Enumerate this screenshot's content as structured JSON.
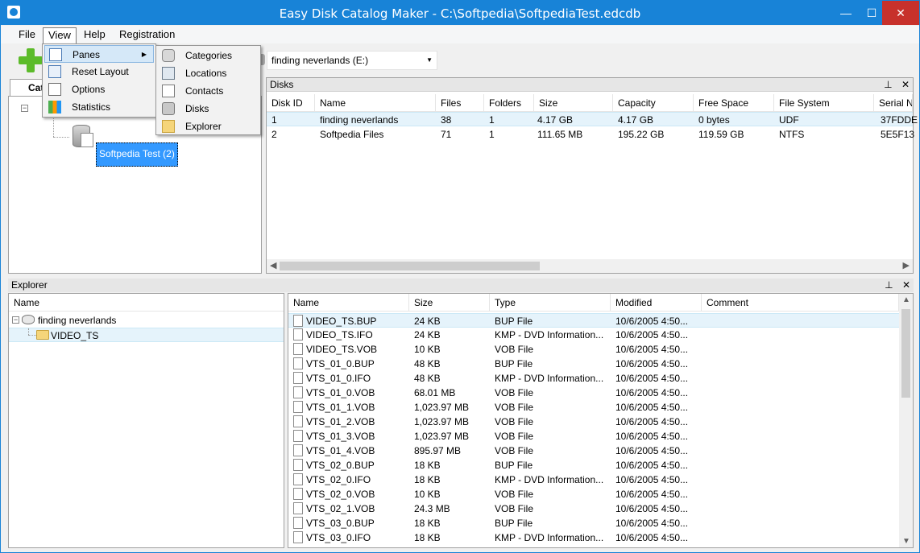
{
  "window": {
    "title": "Easy Disk Catalog Maker - C:\\Softpedia\\SoftpediaTest.edcdb"
  },
  "window_controls": {
    "minimize": "—",
    "maximize": "☐",
    "close": "✕"
  },
  "menubar": [
    "File",
    "View",
    "Help",
    "Registration"
  ],
  "toolbar": {
    "disk_select_value": "finding neverlands (E:)"
  },
  "categories_pane": {
    "tab_label": "Cat",
    "selected_node": "Softpedia Test (2)"
  },
  "view_menu": {
    "items": [
      {
        "label": "Panes",
        "icon": "panes-icon"
      },
      {
        "label": "Reset Layout",
        "icon": "reset-layout-icon"
      },
      {
        "label": "Options",
        "icon": "options-icon"
      },
      {
        "label": "Statistics",
        "icon": "statistics-icon"
      }
    ]
  },
  "panes_submenu": {
    "items": [
      {
        "label": "Categories",
        "icon": "categories-icon"
      },
      {
        "label": "Locations",
        "icon": "locations-icon"
      },
      {
        "label": "Contacts",
        "icon": "contacts-icon"
      },
      {
        "label": "Disks",
        "icon": "disks-icon"
      },
      {
        "label": "Explorer",
        "icon": "explorer-icon"
      }
    ]
  },
  "pane_buttons": {
    "pin": "⊥",
    "close": "✕"
  },
  "disks_pane": {
    "title": "Disks",
    "columns": [
      "Disk ID",
      "Name",
      "Files",
      "Folders",
      "Size",
      "Capacity",
      "Free Space",
      "File System",
      "Serial N"
    ],
    "rows": [
      [
        "1",
        "finding neverlands",
        "38",
        "1",
        "4.17 GB",
        "4.17 GB",
        "0 bytes",
        "UDF",
        "37FDDE"
      ],
      [
        "2",
        "Softpedia Files",
        "71",
        "1",
        "111.65 MB",
        "195.22 GB",
        "119.59 GB",
        "NTFS",
        "5E5F13"
      ]
    ]
  },
  "explorer_pane": {
    "title": "Explorer",
    "tree_header": "Name",
    "tree": [
      "finding neverlands",
      "VIDEO_TS"
    ],
    "columns": [
      "Name",
      "Size",
      "Type",
      "Modified",
      "Comment"
    ],
    "files": [
      [
        "VIDEO_TS.BUP",
        "24 KB",
        "BUP File",
        "10/6/2005 4:50..."
      ],
      [
        "VIDEO_TS.IFO",
        "24 KB",
        "KMP - DVD Information...",
        "10/6/2005 4:50..."
      ],
      [
        "VIDEO_TS.VOB",
        "10 KB",
        "VOB File",
        "10/6/2005 4:50..."
      ],
      [
        "VTS_01_0.BUP",
        "48 KB",
        "BUP File",
        "10/6/2005 4:50..."
      ],
      [
        "VTS_01_0.IFO",
        "48 KB",
        "KMP - DVD Information...",
        "10/6/2005 4:50..."
      ],
      [
        "VTS_01_0.VOB",
        "68.01 MB",
        "VOB File",
        "10/6/2005 4:50..."
      ],
      [
        "VTS_01_1.VOB",
        "1,023.97 MB",
        "VOB File",
        "10/6/2005 4:50..."
      ],
      [
        "VTS_01_2.VOB",
        "1,023.97 MB",
        "VOB File",
        "10/6/2005 4:50..."
      ],
      [
        "VTS_01_3.VOB",
        "1,023.97 MB",
        "VOB File",
        "10/6/2005 4:50..."
      ],
      [
        "VTS_01_4.VOB",
        "895.97 MB",
        "VOB File",
        "10/6/2005 4:50..."
      ],
      [
        "VTS_02_0.BUP",
        "18 KB",
        "BUP File",
        "10/6/2005 4:50..."
      ],
      [
        "VTS_02_0.IFO",
        "18 KB",
        "KMP - DVD Information...",
        "10/6/2005 4:50..."
      ],
      [
        "VTS_02_0.VOB",
        "10 KB",
        "VOB File",
        "10/6/2005 4:50..."
      ],
      [
        "VTS_02_1.VOB",
        "24.3 MB",
        "VOB File",
        "10/6/2005 4:50..."
      ],
      [
        "VTS_03_0.BUP",
        "18 KB",
        "BUP File",
        "10/6/2005 4:50..."
      ],
      [
        "VTS_03_0.IFO",
        "18 KB",
        "KMP - DVD Information...",
        "10/6/2005 4:50..."
      ]
    ]
  },
  "colors": {
    "titlebar": "#1883d7",
    "selection": "#3399ff",
    "row_highlight": "#e5f3fb",
    "close_button": "#c7312b"
  }
}
